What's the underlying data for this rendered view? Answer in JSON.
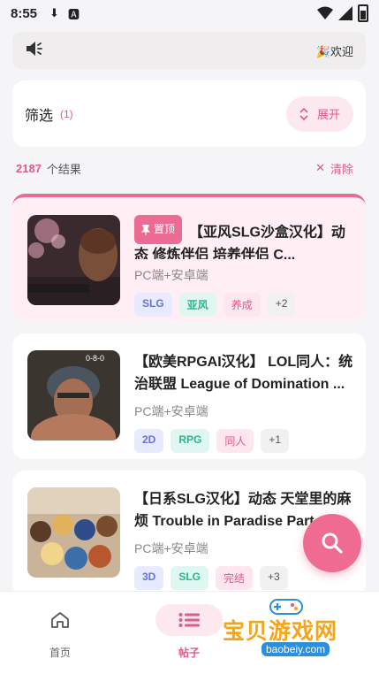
{
  "status_bar": {
    "time": "8:55"
  },
  "notice": {
    "text": "🎉欢迎"
  },
  "filter": {
    "label": "筛选",
    "count": "(1)",
    "expand_label": "展开"
  },
  "results": {
    "count": "2187",
    "unit": "个结果",
    "clear_label": "清除"
  },
  "posts": [
    {
      "pinned": true,
      "pin_label": "置顶",
      "title": "【亚风SLG沙盒汉化】动态 修炼伴侣 培养伴侣 C...",
      "platform": "PC端+安卓端",
      "tags": [
        "SLG",
        "亚风",
        "养成"
      ],
      "more": "+2"
    },
    {
      "pinned": false,
      "title": "【欧美RPGAI汉化】 LOL同人：统治联盟 League of Domination ...",
      "platform": "PC端+安卓端",
      "tags": [
        "2D",
        "RPG",
        "同人"
      ],
      "more": "+1",
      "thumb_text": "0-8-0"
    },
    {
      "pinned": false,
      "title": "【日系SLG汉化】动态 天堂里的麻烦 Trouble in Paradise Part...",
      "platform": "PC端+安卓端",
      "tags": [
        "3D",
        "SLG",
        "完结"
      ],
      "more": "+3"
    }
  ],
  "nav": [
    {
      "label": "首页",
      "icon": "home-icon"
    },
    {
      "label": "帖子",
      "icon": "list-icon",
      "active": true
    }
  ],
  "watermark": {
    "title": "宝贝游戏网",
    "url": "baobeiy.com"
  },
  "colors": {
    "accent": "#e05a86",
    "pin_bg": "#ffeef3"
  }
}
